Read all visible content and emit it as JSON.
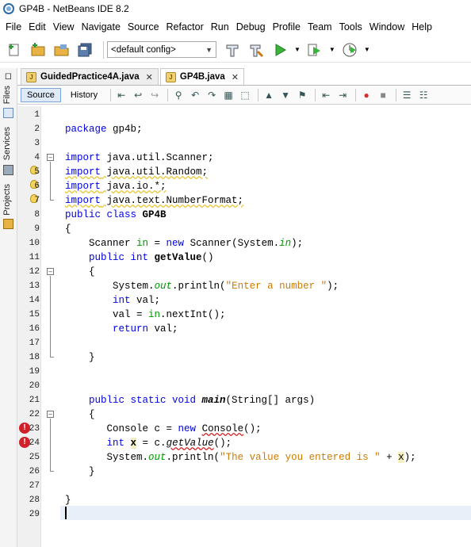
{
  "window": {
    "title": "GP4B - NetBeans IDE 8.2"
  },
  "menu": [
    "File",
    "Edit",
    "View",
    "Navigate",
    "Source",
    "Refactor",
    "Run",
    "Debug",
    "Profile",
    "Team",
    "Tools",
    "Window",
    "Help"
  ],
  "toolbar": {
    "config": "<default config>"
  },
  "side_tabs": [
    "Files",
    "Services",
    "Projects"
  ],
  "tabs": [
    {
      "label": "GuidedPractice4A.java"
    },
    {
      "label": "GP4B.java"
    }
  ],
  "editor_toolbar": {
    "source": "Source",
    "history": "History"
  },
  "line_numbers": [
    "1",
    "2",
    "3",
    "4",
    "5",
    "6",
    "7",
    "8",
    "9",
    "10",
    "11",
    "12",
    "13",
    "14",
    "15",
    "16",
    "17",
    "18",
    "19",
    "20",
    "21",
    "22",
    "23",
    "24",
    "25",
    "26",
    "27",
    "28",
    "29"
  ],
  "code": {
    "l2a": "package",
    "l2b": " gp4b;",
    "l4a": "import",
    "l4b": " java.util.Scanner;",
    "l5a": "import",
    "l5b": " java.util.Random;",
    "l6a": "import",
    "l6b": " java.io.*;",
    "l7a": "import",
    "l7b": " java.text.NumberFormat;",
    "l8a": "public class",
    "l8b": " GP4B",
    "l9": "{",
    "l10a": "    Scanner ",
    "l10b": "in",
    "l10c": " = ",
    "l10d": "new",
    "l10e": " Scanner(System.",
    "l10f": "in",
    "l10g": ");",
    "l11a": "    public int ",
    "l11b": "getValue",
    "l11c": "()",
    "l12": "    {",
    "l13a": "        System.",
    "l13b": "out",
    "l13c": ".println(",
    "l13d": "\"Enter a number \"",
    "l13e": ");",
    "l14a": "        int",
    "l14b": " val;",
    "l15a": "        val = ",
    "l15b": "in",
    "l15c": ".nextInt();",
    "l16a": "        return",
    "l16b": " val;",
    "l18": "    }",
    "l21a": "    public static void ",
    "l21b": "main",
    "l21c": "(String[] args)",
    "l22": "    {",
    "l23a": "       Console c = ",
    "l23b": "new",
    "l23c": " ",
    "l23d": "Console",
    "l23e": "();",
    "l24a": "       int",
    "l24b": " ",
    "l24c": "x",
    "l24d": " = c.",
    "l24e": "getValue",
    "l24f": "();",
    "l25a": "       System.",
    "l25b": "out",
    "l25c": ".println(",
    "l25d": "\"The value you entered is \"",
    "l25e": " + ",
    "l25f": "x",
    "l25g": ");",
    "l26": "    }",
    "l28": "}"
  }
}
